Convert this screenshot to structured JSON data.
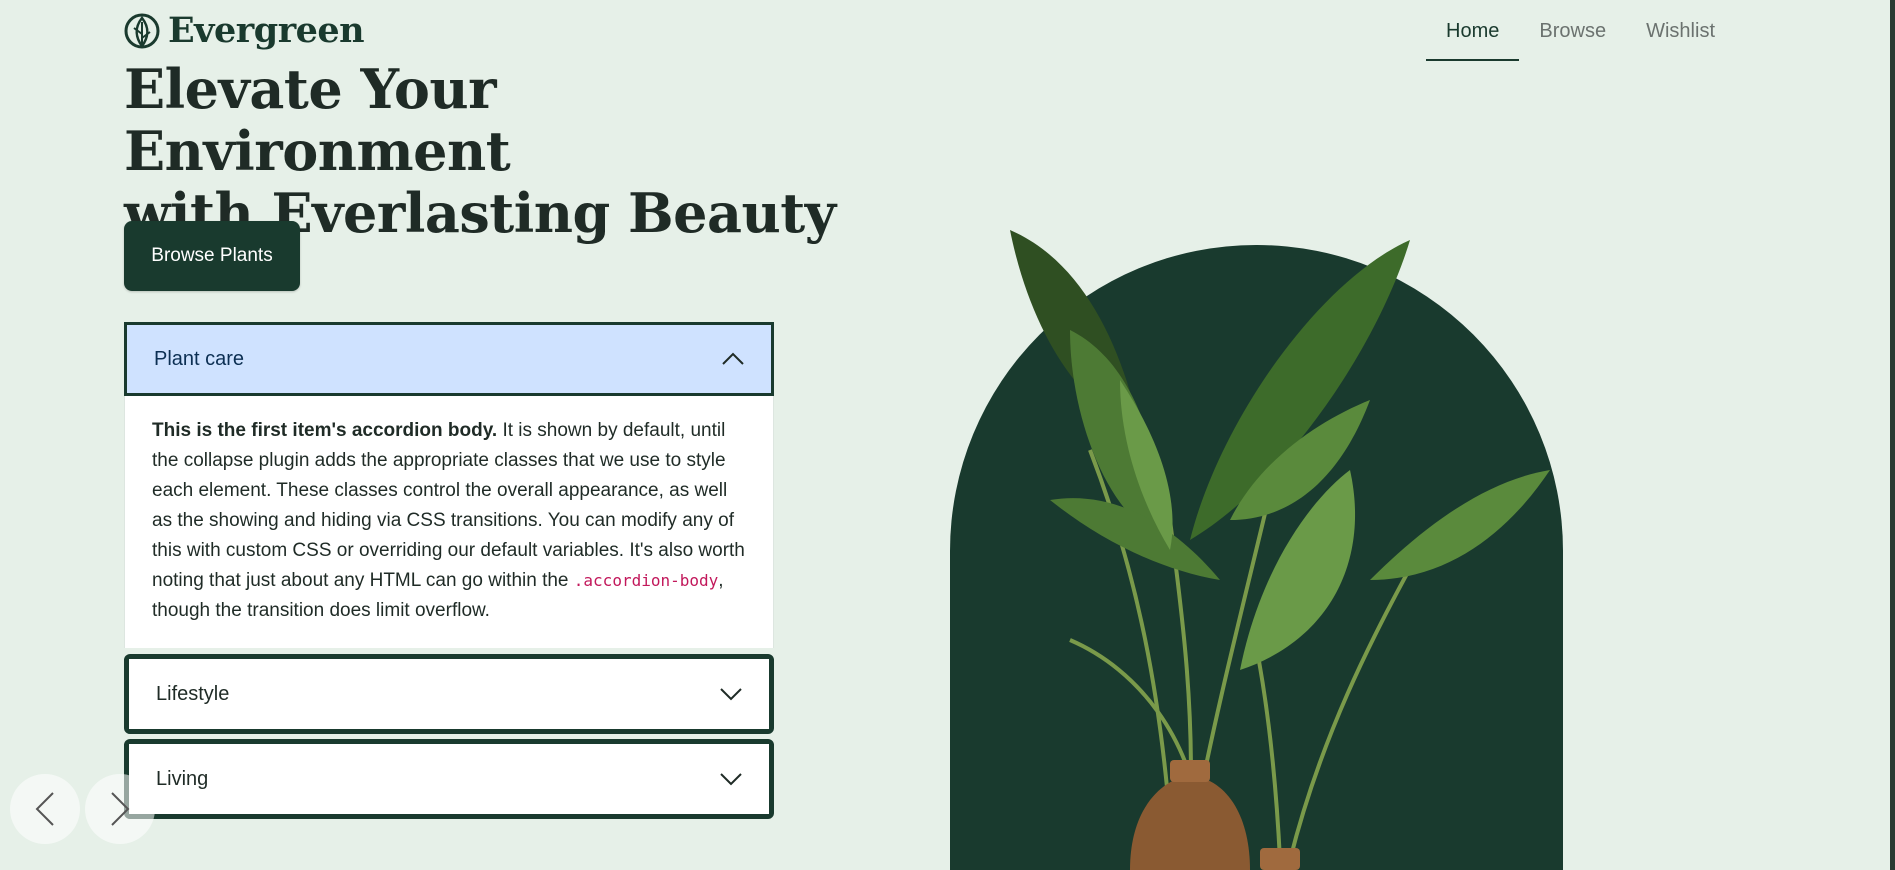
{
  "brand": {
    "name": "Evergreen",
    "logo_icon": "leaf-icon"
  },
  "nav": {
    "items": [
      {
        "label": "Home",
        "active": true
      },
      {
        "label": "Browse",
        "active": false
      },
      {
        "label": "Wishlist",
        "active": false
      }
    ]
  },
  "hero": {
    "title_line1": "Elevate Your Environment",
    "title_line2": "with Everlasting Beauty",
    "cta_label": "Browse Plants"
  },
  "accordion": {
    "items": [
      {
        "title": "Plant care",
        "open": true,
        "body_strong": "This is the first item's accordion body.",
        "body_text1": " It is shown by default, until the collapse plugin adds the appropriate classes that we use to style each element. These classes control the overall appearance, as well as the showing and hiding via CSS transitions. You can modify any of this with custom CSS or overriding our default variables. It's also worth noting that just about any HTML can go within the ",
        "body_code": ".accordion-body",
        "body_text2": ", though the transition does limit overflow."
      },
      {
        "title": "Lifestyle",
        "open": false
      },
      {
        "title": "Living",
        "open": false
      }
    ]
  },
  "carousel": {
    "prev_icon": "chevron-left-icon",
    "next_icon": "chevron-right-icon"
  },
  "colors": {
    "brand_dark": "#193a2e",
    "background": "#e6f0e8",
    "accordion_active": "#cfe2ff"
  }
}
